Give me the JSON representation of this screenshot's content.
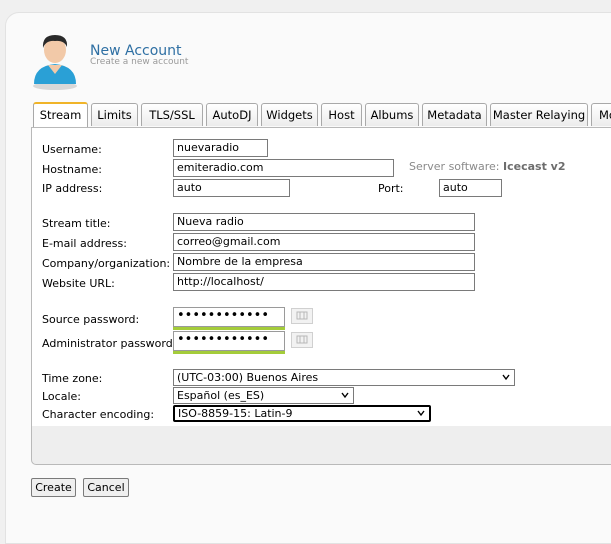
{
  "header": {
    "title": "New Account",
    "subtitle": "Create a new account"
  },
  "tabs": [
    {
      "label": "Stream",
      "active": true
    },
    {
      "label": "Limits"
    },
    {
      "label": "TLS/SSL"
    },
    {
      "label": "AutoDJ"
    },
    {
      "label": "Widgets"
    },
    {
      "label": "Host"
    },
    {
      "label": "Albums"
    },
    {
      "label": "Metadata"
    },
    {
      "label": "Master Relaying"
    },
    {
      "label": "Mo"
    }
  ],
  "form": {
    "username": {
      "label": "Username:",
      "value": "nuevaradio"
    },
    "hostname": {
      "label": "Hostname:",
      "value": "emiteradio.com"
    },
    "server_software": {
      "label": "Server software:",
      "value": "Icecast v2"
    },
    "ip_address": {
      "label": "IP address:",
      "value": "auto"
    },
    "port": {
      "label": "Port:",
      "value": "auto"
    },
    "stream_title": {
      "label": "Stream title:",
      "value": "Nueva radio"
    },
    "email": {
      "label": "E-mail address:",
      "value": "correo@gmail.com"
    },
    "company": {
      "label": "Company/organization:",
      "value": "Nombre de la empresa"
    },
    "website": {
      "label": "Website URL:",
      "value": "http://localhost/"
    },
    "source_password": {
      "label": "Source password:",
      "value": "••••••••••••"
    },
    "admin_password": {
      "label": "Administrator password:",
      "value": "••••••••••••"
    },
    "time_zone": {
      "label": "Time zone:",
      "value": "(UTC-03:00) Buenos Aires"
    },
    "locale": {
      "label": "Locale:",
      "value": "Español (es_ES)"
    },
    "encoding": {
      "label": "Character encoding:",
      "value": "ISO-8859-15: Latin-9"
    }
  },
  "buttons": {
    "create": "Create",
    "cancel": "Cancel"
  },
  "colors": {
    "title": "#2e6fa3",
    "active_tab_accent": "#f0b429",
    "password_strength": "#a4cc3a"
  }
}
